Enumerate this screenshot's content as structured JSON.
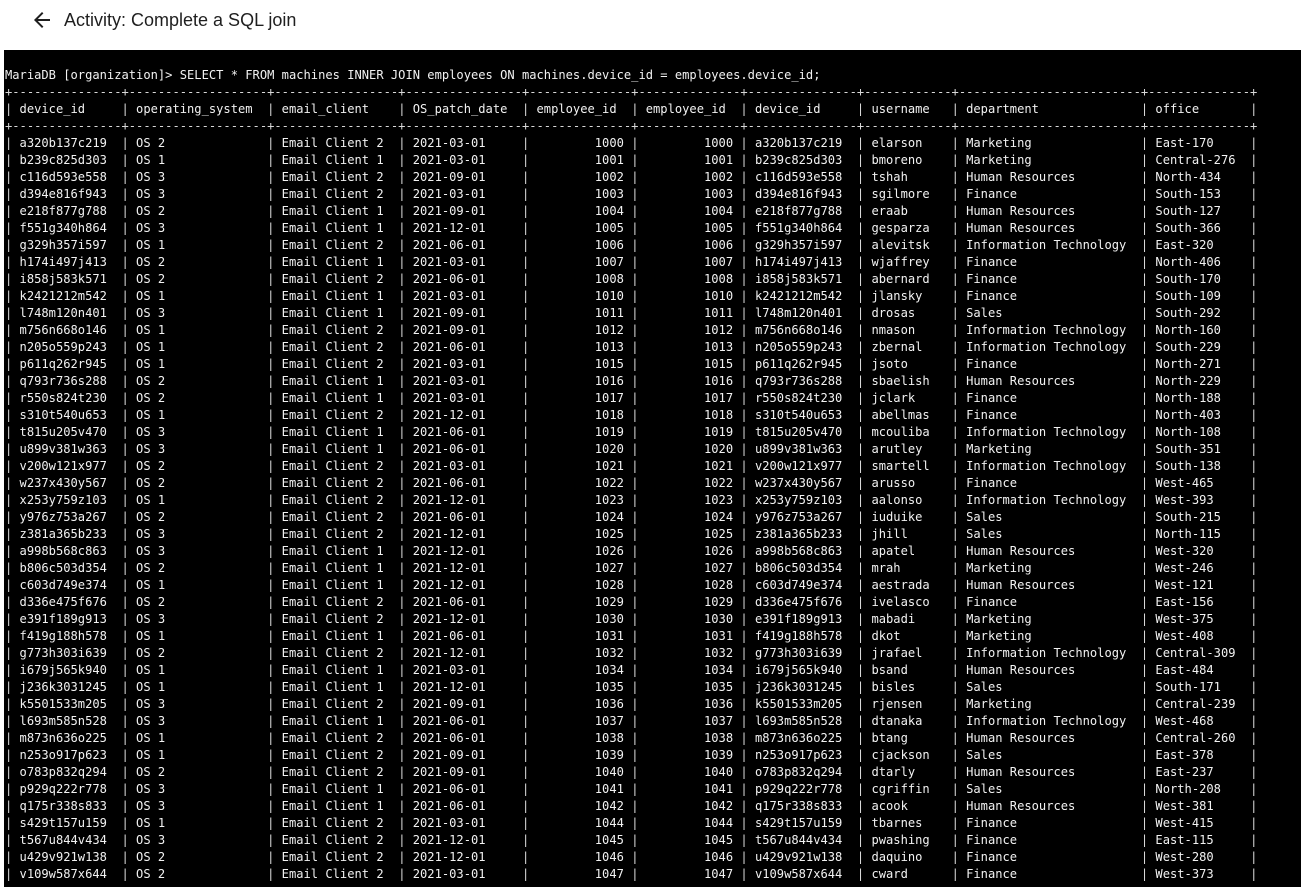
{
  "header": {
    "title": "Activity: Complete a SQL join"
  },
  "terminal": {
    "prompt": "MariaDB [organization]>",
    "query": "SELECT * FROM machines INNER JOIN employees ON machines.device_id = employees.device_id;",
    "columns": [
      "device_id",
      "operating_system",
      "email_client",
      "OS_patch_date",
      "employee_id",
      "employee_id",
      "device_id",
      "username",
      "department",
      "office"
    ],
    "rows": [
      [
        "a320b137c219",
        "OS 2",
        "Email Client 2",
        "2021-03-01",
        "1000",
        "1000",
        "a320b137c219",
        "elarson",
        "Marketing",
        "East-170"
      ],
      [
        "b239c825d303",
        "OS 1",
        "Email Client 1",
        "2021-03-01",
        "1001",
        "1001",
        "b239c825d303",
        "bmoreno",
        "Marketing",
        "Central-276"
      ],
      [
        "c116d593e558",
        "OS 3",
        "Email Client 2",
        "2021-09-01",
        "1002",
        "1002",
        "c116d593e558",
        "tshah",
        "Human Resources",
        "North-434"
      ],
      [
        "d394e816f943",
        "OS 3",
        "Email Client 2",
        "2021-03-01",
        "1003",
        "1003",
        "d394e816f943",
        "sgilmore",
        "Finance",
        "South-153"
      ],
      [
        "e218f877g788",
        "OS 2",
        "Email Client 1",
        "2021-09-01",
        "1004",
        "1004",
        "e218f877g788",
        "eraab",
        "Human Resources",
        "South-127"
      ],
      [
        "f551g340h864",
        "OS 3",
        "Email Client 1",
        "2021-12-01",
        "1005",
        "1005",
        "f551g340h864",
        "gesparza",
        "Human Resources",
        "South-366"
      ],
      [
        "g329h357i597",
        "OS 1",
        "Email Client 2",
        "2021-06-01",
        "1006",
        "1006",
        "g329h357i597",
        "alevitsk",
        "Information Technology",
        "East-320"
      ],
      [
        "h174i497j413",
        "OS 2",
        "Email Client 1",
        "2021-03-01",
        "1007",
        "1007",
        "h174i497j413",
        "wjaffrey",
        "Finance",
        "North-406"
      ],
      [
        "i858j583k571",
        "OS 2",
        "Email Client 2",
        "2021-06-01",
        "1008",
        "1008",
        "i858j583k571",
        "abernard",
        "Finance",
        "South-170"
      ],
      [
        "k2421212m542",
        "OS 1",
        "Email Client 1",
        "2021-03-01",
        "1010",
        "1010",
        "k2421212m542",
        "jlansky",
        "Finance",
        "South-109"
      ],
      [
        "l748m120n401",
        "OS 3",
        "Email Client 1",
        "2021-09-01",
        "1011",
        "1011",
        "l748m120n401",
        "drosas",
        "Sales",
        "South-292"
      ],
      [
        "m756n668o146",
        "OS 1",
        "Email Client 2",
        "2021-09-01",
        "1012",
        "1012",
        "m756n668o146",
        "nmason",
        "Information Technology",
        "North-160"
      ],
      [
        "n205o559p243",
        "OS 1",
        "Email Client 2",
        "2021-06-01",
        "1013",
        "1013",
        "n205o559p243",
        "zbernal",
        "Information Technology",
        "South-229"
      ],
      [
        "p611q262r945",
        "OS 1",
        "Email Client 2",
        "2021-03-01",
        "1015",
        "1015",
        "p611q262r945",
        "jsoto",
        "Finance",
        "North-271"
      ],
      [
        "q793r736s288",
        "OS 2",
        "Email Client 1",
        "2021-03-01",
        "1016",
        "1016",
        "q793r736s288",
        "sbaelish",
        "Human Resources",
        "North-229"
      ],
      [
        "r550s824t230",
        "OS 2",
        "Email Client 1",
        "2021-03-01",
        "1017",
        "1017",
        "r550s824t230",
        "jclark",
        "Finance",
        "North-188"
      ],
      [
        "s310t540u653",
        "OS 1",
        "Email Client 2",
        "2021-12-01",
        "1018",
        "1018",
        "s310t540u653",
        "abellmas",
        "Finance",
        "North-403"
      ],
      [
        "t815u205v470",
        "OS 3",
        "Email Client 1",
        "2021-06-01",
        "1019",
        "1019",
        "t815u205v470",
        "mcouliba",
        "Information Technology",
        "North-108"
      ],
      [
        "u899v381w363",
        "OS 3",
        "Email Client 1",
        "2021-06-01",
        "1020",
        "1020",
        "u899v381w363",
        "arutley",
        "Marketing",
        "South-351"
      ],
      [
        "v200w121x977",
        "OS 2",
        "Email Client 2",
        "2021-03-01",
        "1021",
        "1021",
        "v200w121x977",
        "smartell",
        "Information Technology",
        "South-138"
      ],
      [
        "w237x430y567",
        "OS 2",
        "Email Client 2",
        "2021-06-01",
        "1022",
        "1022",
        "w237x430y567",
        "arusso",
        "Finance",
        "West-465"
      ],
      [
        "x253y759z103",
        "OS 1",
        "Email Client 2",
        "2021-12-01",
        "1023",
        "1023",
        "x253y759z103",
        "aalonso",
        "Information Technology",
        "West-393"
      ],
      [
        "y976z753a267",
        "OS 2",
        "Email Client 2",
        "2021-06-01",
        "1024",
        "1024",
        "y976z753a267",
        "iuduike",
        "Sales",
        "South-215"
      ],
      [
        "z381a365b233",
        "OS 3",
        "Email Client 2",
        "2021-12-01",
        "1025",
        "1025",
        "z381a365b233",
        "jhill",
        "Sales",
        "North-115"
      ],
      [
        "a998b568c863",
        "OS 3",
        "Email Client 1",
        "2021-12-01",
        "1026",
        "1026",
        "a998b568c863",
        "apatel",
        "Human Resources",
        "West-320"
      ],
      [
        "b806c503d354",
        "OS 2",
        "Email Client 1",
        "2021-12-01",
        "1027",
        "1027",
        "b806c503d354",
        "mrah",
        "Marketing",
        "West-246"
      ],
      [
        "c603d749e374",
        "OS 1",
        "Email Client 1",
        "2021-12-01",
        "1028",
        "1028",
        "c603d749e374",
        "aestrada",
        "Human Resources",
        "West-121"
      ],
      [
        "d336e475f676",
        "OS 2",
        "Email Client 2",
        "2021-06-01",
        "1029",
        "1029",
        "d336e475f676",
        "ivelasco",
        "Finance",
        "East-156"
      ],
      [
        "e391f189g913",
        "OS 3",
        "Email Client 2",
        "2021-12-01",
        "1030",
        "1030",
        "e391f189g913",
        "mabadi",
        "Marketing",
        "West-375"
      ],
      [
        "f419g188h578",
        "OS 1",
        "Email Client 1",
        "2021-06-01",
        "1031",
        "1031",
        "f419g188h578",
        "dkot",
        "Marketing",
        "West-408"
      ],
      [
        "g773h303i639",
        "OS 2",
        "Email Client 2",
        "2021-12-01",
        "1032",
        "1032",
        "g773h303i639",
        "jrafael",
        "Information Technology",
        "Central-309"
      ],
      [
        "i679j565k940",
        "OS 1",
        "Email Client 1",
        "2021-03-01",
        "1034",
        "1034",
        "i679j565k940",
        "bsand",
        "Human Resources",
        "East-484"
      ],
      [
        "j236k3031245",
        "OS 1",
        "Email Client 1",
        "2021-12-01",
        "1035",
        "1035",
        "j236k3031245",
        "bisles",
        "Sales",
        "South-171"
      ],
      [
        "k5501533m205",
        "OS 3",
        "Email Client 2",
        "2021-09-01",
        "1036",
        "1036",
        "k5501533m205",
        "rjensen",
        "Marketing",
        "Central-239"
      ],
      [
        "l693m585n528",
        "OS 3",
        "Email Client 1",
        "2021-06-01",
        "1037",
        "1037",
        "l693m585n528",
        "dtanaka",
        "Information Technology",
        "West-468"
      ],
      [
        "m873n636o225",
        "OS 1",
        "Email Client 2",
        "2021-06-01",
        "1038",
        "1038",
        "m873n636o225",
        "btang",
        "Human Resources",
        "Central-260"
      ],
      [
        "n253o917p623",
        "OS 1",
        "Email Client 2",
        "2021-09-01",
        "1039",
        "1039",
        "n253o917p623",
        "cjackson",
        "Sales",
        "East-378"
      ],
      [
        "o783p832q294",
        "OS 2",
        "Email Client 2",
        "2021-09-01",
        "1040",
        "1040",
        "o783p832q294",
        "dtarly",
        "Human Resources",
        "East-237"
      ],
      [
        "p929q222r778",
        "OS 3",
        "Email Client 1",
        "2021-06-01",
        "1041",
        "1041",
        "p929q222r778",
        "cgriffin",
        "Sales",
        "North-208"
      ],
      [
        "q175r338s833",
        "OS 3",
        "Email Client 1",
        "2021-06-01",
        "1042",
        "1042",
        "q175r338s833",
        "acook",
        "Human Resources",
        "West-381"
      ],
      [
        "s429t157u159",
        "OS 1",
        "Email Client 2",
        "2021-03-01",
        "1044",
        "1044",
        "s429t157u159",
        "tbarnes",
        "Finance",
        "West-415"
      ],
      [
        "t567u844v434",
        "OS 3",
        "Email Client 2",
        "2021-12-01",
        "1045",
        "1045",
        "t567u844v434",
        "pwashing",
        "Finance",
        "East-115"
      ],
      [
        "u429v921w138",
        "OS 2",
        "Email Client 2",
        "2021-12-01",
        "1046",
        "1046",
        "u429v921w138",
        "daquino",
        "Finance",
        "West-280"
      ],
      [
        "v109w587x644",
        "OS 2",
        "Email Client 2",
        "2021-03-01",
        "1047",
        "1047",
        "v109w587x644",
        "cward",
        "Finance",
        "West-373"
      ]
    ]
  }
}
